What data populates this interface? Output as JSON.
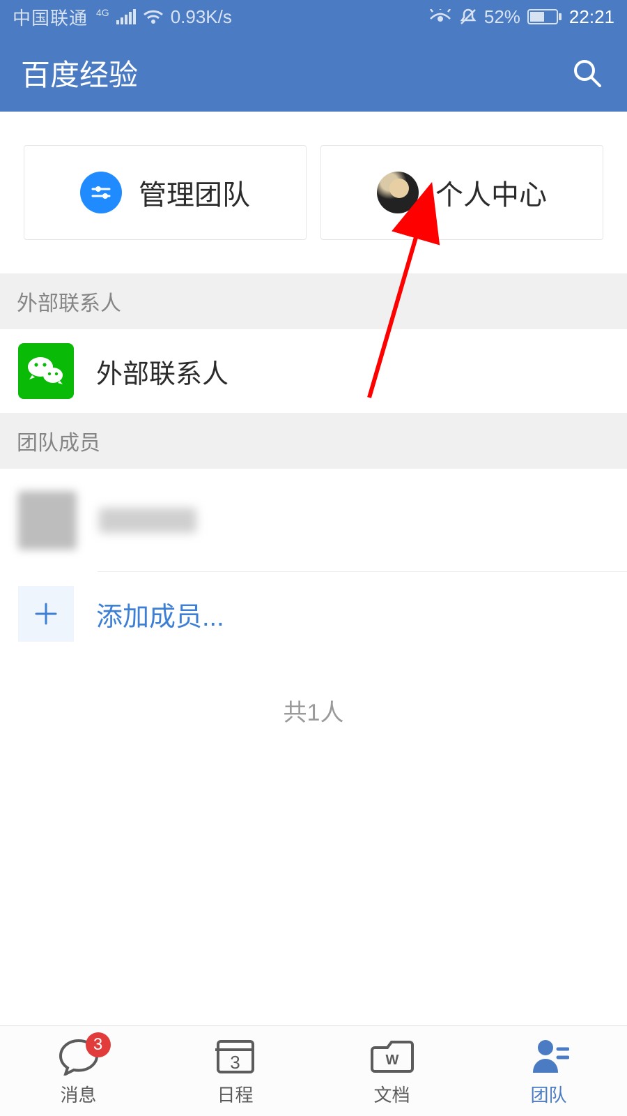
{
  "status": {
    "carrier": "中国联通",
    "network_tag": "4G",
    "speed": "0.93K/s",
    "battery_pct": "52%",
    "time": "22:21"
  },
  "header": {
    "title": "百度经验"
  },
  "cards": {
    "manage_team": "管理团队",
    "personal_center": "个人中心"
  },
  "sections": {
    "external_header": "外部联系人",
    "external_row_label": "外部联系人",
    "team_header": "团队成员",
    "add_member_label": "添加成员...",
    "total_count": "共1人"
  },
  "nav": {
    "messages": {
      "label": "消息",
      "badge": "3"
    },
    "calendar": {
      "label": "日程",
      "day": "3"
    },
    "docs": {
      "label": "文档"
    },
    "team": {
      "label": "团队"
    }
  }
}
